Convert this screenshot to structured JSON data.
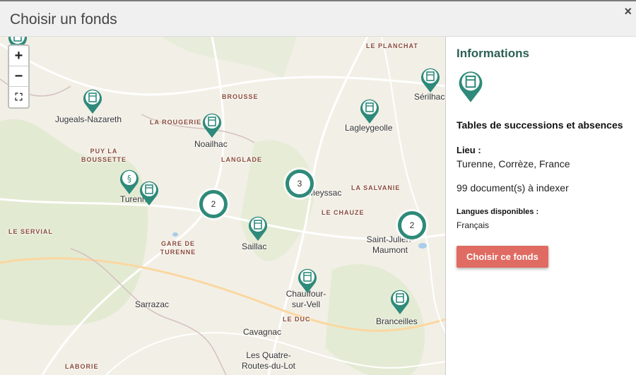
{
  "modal": {
    "title": "Choisir un fonds",
    "close_label": "×"
  },
  "map": {
    "zoom_in": "+",
    "zoom_out": "−",
    "fullscreen": "⛶",
    "labels": [
      {
        "text": "Jugeals-Nazareth",
        "kind": "town"
      },
      {
        "text": "Noailhac",
        "kind": "town"
      },
      {
        "text": "Lagleygeolle",
        "kind": "town"
      },
      {
        "text": "Sérilhac",
        "kind": "town"
      },
      {
        "text": "Turenne",
        "kind": "town"
      },
      {
        "text": "Meyssac",
        "kind": "town"
      },
      {
        "text": "Saillac",
        "kind": "town"
      },
      {
        "text": "Saint-Julien-Maumont",
        "kind": "town"
      },
      {
        "text": "Chauffour-sur-Vell",
        "kind": "town"
      },
      {
        "text": "Branceilles",
        "kind": "town"
      },
      {
        "text": "Sarrazac",
        "kind": "town"
      },
      {
        "text": "Cavagnac",
        "kind": "town"
      },
      {
        "text": "Les Quatre-Routes-du-Lot",
        "kind": "town"
      },
      {
        "text": "LE PLANCHAT",
        "kind": "area"
      },
      {
        "text": "BROUSSE",
        "kind": "area"
      },
      {
        "text": "LA ROUGERIE",
        "kind": "area"
      },
      {
        "text": "PUY LA BOUSSETTE",
        "kind": "area"
      },
      {
        "text": "LANGLADE",
        "kind": "area"
      },
      {
        "text": "LA SALVANIE",
        "kind": "area"
      },
      {
        "text": "LE CHAUZE",
        "kind": "area"
      },
      {
        "text": "LE SERVIAL",
        "kind": "area"
      },
      {
        "text": "GARE DE TURENNE",
        "kind": "area"
      },
      {
        "text": "LE DUC",
        "kind": "area"
      },
      {
        "text": "LABORIE",
        "kind": "area"
      }
    ],
    "clusters": [
      {
        "count": "2"
      },
      {
        "count": "3"
      },
      {
        "count": "2"
      }
    ]
  },
  "panel": {
    "heading": "Informations",
    "fonds_title": "Tables de successions et absences",
    "lieu_label": "Lieu :",
    "lieu_value": "Turenne, Corrèze, France",
    "documents": "99 document(s) à indexer",
    "langues_label": "Langues disponibles :",
    "langues_value": "Français",
    "choose_button": "Choisir ce fonds"
  },
  "colors": {
    "marker": "#2e8a7a",
    "button": "#e06b62",
    "heading": "#2d5f55"
  }
}
